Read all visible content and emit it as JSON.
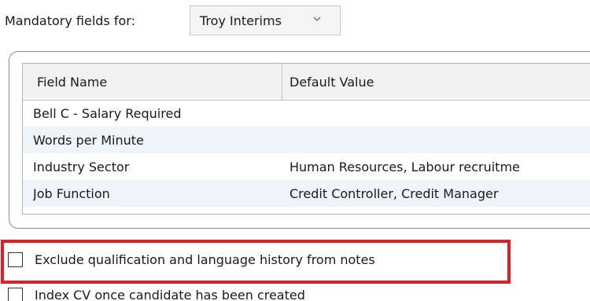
{
  "mandatory": {
    "label": "Mandatory fields for:",
    "selected": "Troy Interims"
  },
  "table": {
    "columns": [
      "Field Name",
      "Default Value"
    ],
    "rows": [
      {
        "field": "Bell C - Salary Required",
        "value": ""
      },
      {
        "field": "Words per Minute",
        "value": ""
      },
      {
        "field": "Industry Sector",
        "value": "Human Resources, Labour recruitme"
      },
      {
        "field": "Job Function",
        "value": "Credit Controller, Credit Manager"
      }
    ]
  },
  "options": {
    "exclude_history": {
      "label": "Exclude qualification and language history from notes",
      "checked": false
    },
    "index_cv": {
      "label": "Index CV once candidate has been created",
      "checked": false
    }
  },
  "colors": {
    "highlight": "#e02026",
    "alt_row": "#eef4fa"
  },
  "icons": {
    "dropdown": "chevron-down-icon"
  }
}
